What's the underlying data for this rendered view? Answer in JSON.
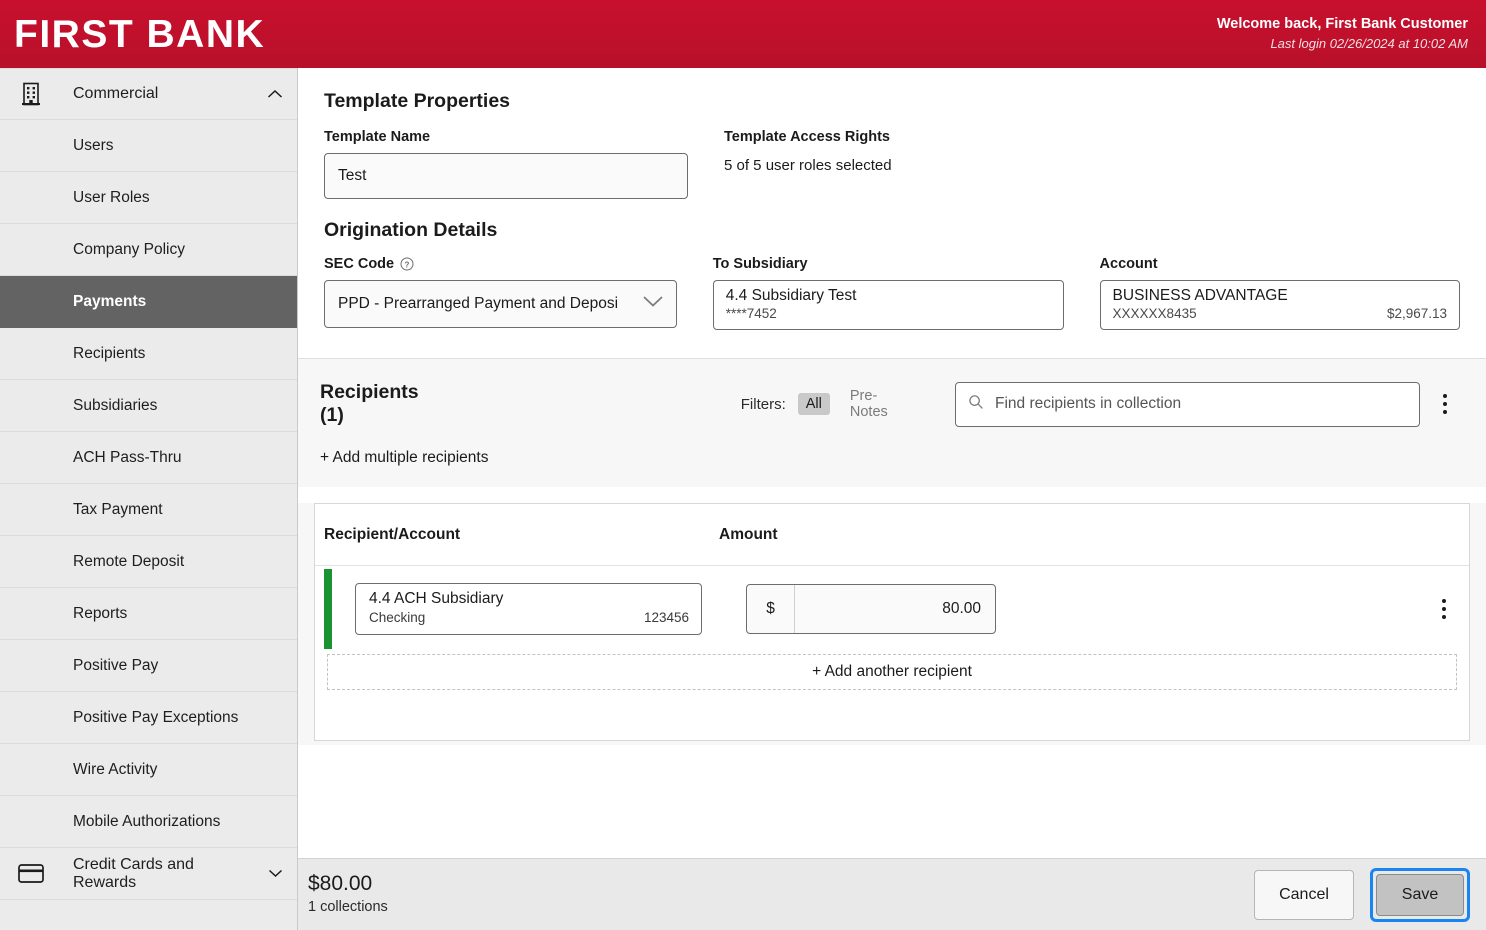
{
  "header": {
    "brand": "FIRST BANK",
    "welcome_line": "Welcome back, First Bank Customer",
    "last_login": "Last login 02/26/2024 at 10:02 AM",
    "brand_color": "#c8102e"
  },
  "sidebar": {
    "group": {
      "label": "Commercial",
      "icon": "building-icon",
      "expanded": true
    },
    "items": [
      {
        "label": "Users",
        "active": false
      },
      {
        "label": "User Roles",
        "active": false
      },
      {
        "label": "Company Policy",
        "active": false
      },
      {
        "label": "Payments",
        "active": true
      },
      {
        "label": "Recipients",
        "active": false
      },
      {
        "label": "Subsidiaries",
        "active": false
      },
      {
        "label": "ACH Pass-Thru",
        "active": false
      },
      {
        "label": "Tax Payment",
        "active": false
      },
      {
        "label": "Remote Deposit",
        "active": false
      },
      {
        "label": "Reports",
        "active": false
      },
      {
        "label": "Positive Pay",
        "active": false
      },
      {
        "label": "Positive Pay Exceptions",
        "active": false
      },
      {
        "label": "Wire Activity",
        "active": false
      },
      {
        "label": "Mobile Authorizations",
        "active": false
      }
    ],
    "bottom_group": {
      "label": "Credit Cards and Rewards",
      "icon": "credit-card-icon",
      "expanded": false
    }
  },
  "template_properties": {
    "title": "Template Properties",
    "name_label": "Template Name",
    "name_value": "Test",
    "access_label": "Template Access Rights",
    "access_value": "5 of 5 user roles selected"
  },
  "origination": {
    "title": "Origination Details",
    "sec_code_label": "SEC Code",
    "sec_code_value": "PPD - Prearranged Payment and Deposi",
    "subsidiary_label": "To Subsidiary",
    "subsidiary_name": "4.4 Subsidiary Test",
    "subsidiary_number": "****7452",
    "account_label": "Account",
    "account_name": "BUSINESS ADVANTAGE",
    "account_number": "XXXXXX8435",
    "account_balance": "$2,967.13"
  },
  "recipients": {
    "title": "Recipients (1)",
    "filters_label": "Filters:",
    "filter_all": "All",
    "filter_prenotes": "Pre-Notes",
    "search_placeholder": "Find recipients in collection",
    "search_value": "",
    "add_multiple": "+ Add multiple recipients",
    "columns": [
      "Recipient/Account",
      "Amount"
    ],
    "rows": [
      {
        "name": "4.4 ACH Subsidiary",
        "account_type": "Checking",
        "account_number": "123456",
        "currency_symbol": "$",
        "amount": "80.00",
        "status_color": "#1a9431"
      }
    ],
    "add_another": "+ Add another recipient"
  },
  "footer": {
    "total": "$80.00",
    "collections": "1 collections",
    "cancel_label": "Cancel",
    "save_label": "Save",
    "focus_color": "#1a84f0"
  }
}
